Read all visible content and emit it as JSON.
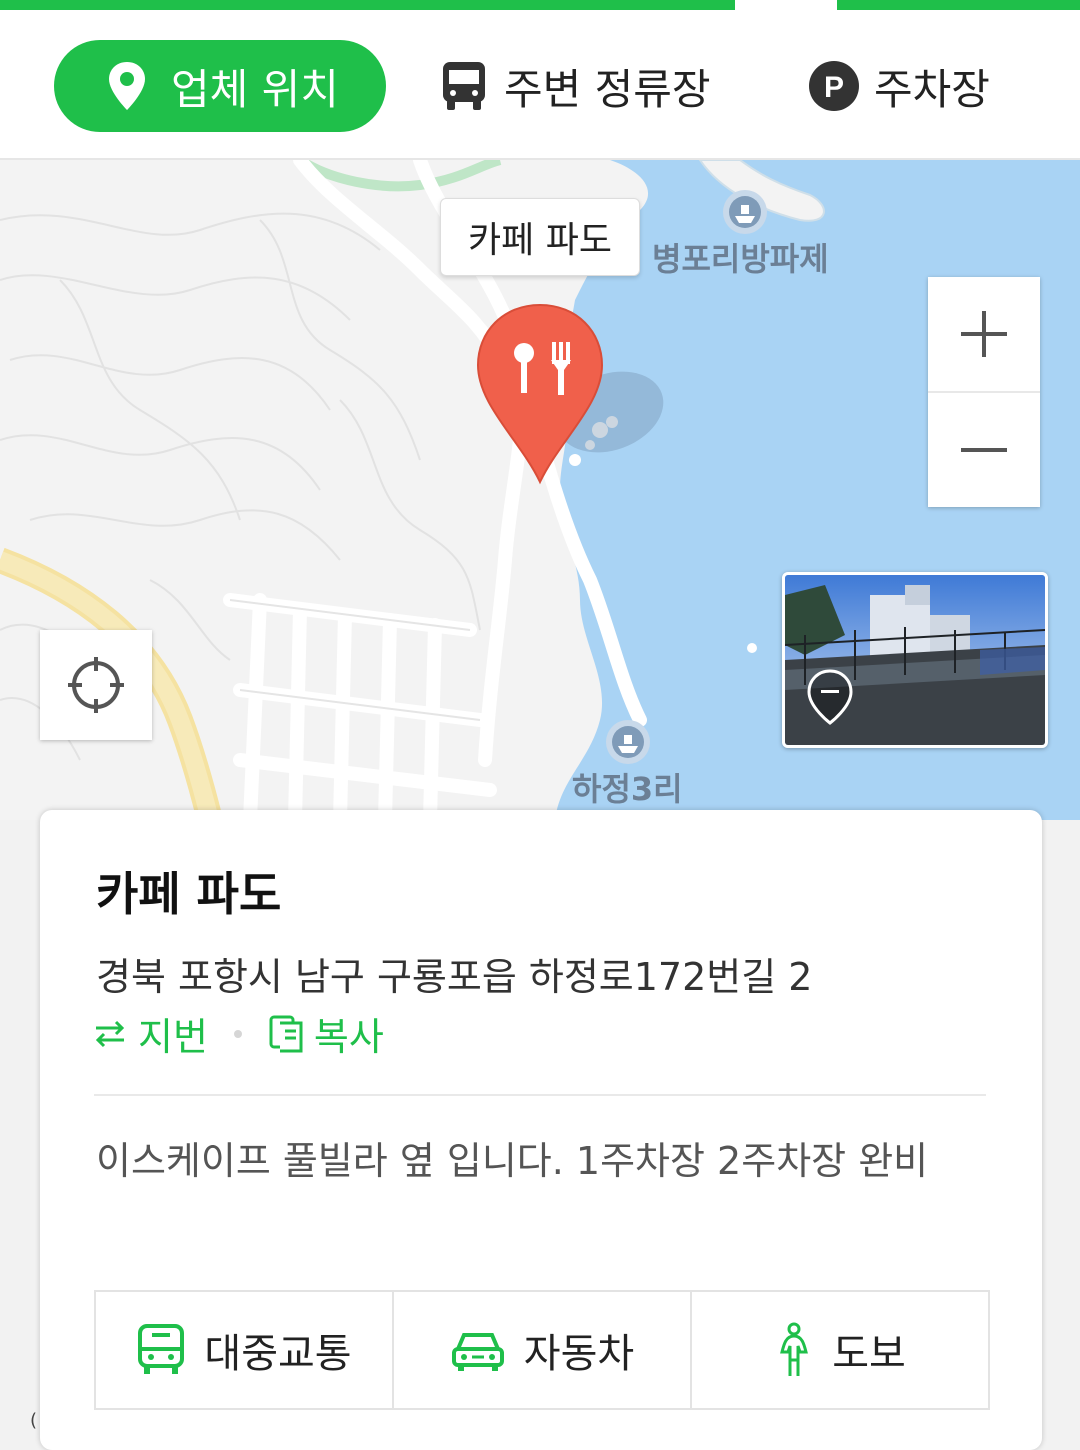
{
  "tabs": {
    "location": "업체 위치",
    "bus_stop": "주변 정류장",
    "parking": "주차장",
    "parking_badge": "P"
  },
  "map": {
    "place_label": "카페 파도",
    "labels": {
      "breakwater": "병포리방파제",
      "village": "하정3리"
    },
    "zoom_in": "+",
    "zoom_out": "−",
    "colors": {
      "sea": "#a9d3f4",
      "land": "#f3f3f3",
      "pin": "#f0604b",
      "accent": "#1fbf4a"
    }
  },
  "place": {
    "name": "카페 파도",
    "address": "경북 포항시 남구 구룡포읍 하정로172번길 2",
    "lot_number_label": "지번",
    "copy_label": "복사",
    "description": "이스케이프 풀빌라 옆 입니다. 1주차장 2주차장 완비"
  },
  "routes": {
    "transit": "대중교통",
    "car": "자동차",
    "walk": "도보"
  },
  "footer_char": "("
}
